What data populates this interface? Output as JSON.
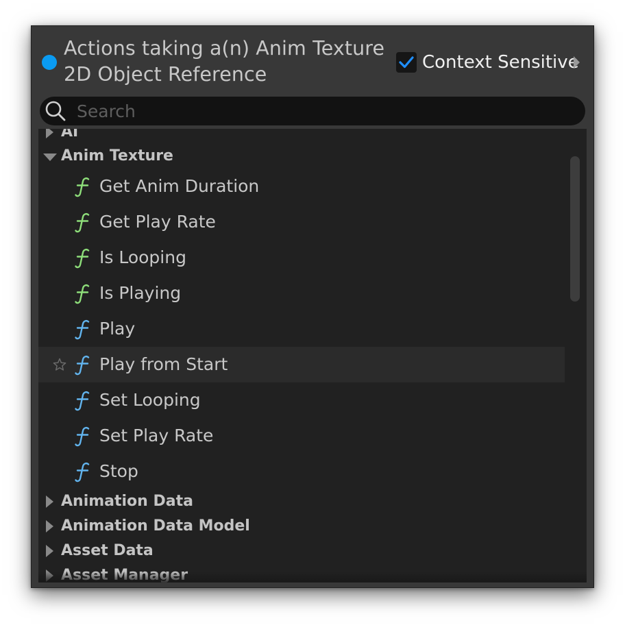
{
  "header": {
    "title": "Actions taking a(n) Anim Texture 2D Object Reference",
    "context_sensitive_label": "Context Sensitive",
    "context_sensitive_checked": true,
    "pin_color": "#0a9bf2"
  },
  "search": {
    "placeholder": "Search",
    "value": ""
  },
  "categories": {
    "ai": "AI",
    "anim_texture": "Anim Texture",
    "animation_data": "Animation Data",
    "animation_data_model": "Animation Data Model",
    "asset_data": "Asset Data",
    "asset_manager": "Asset Manager"
  },
  "anim_texture_items": [
    {
      "label": "Get Anim Duration",
      "icon": "function-pure-icon",
      "icon_color": "#8ede7a"
    },
    {
      "label": "Get Play Rate",
      "icon": "function-pure-icon",
      "icon_color": "#8ede7a"
    },
    {
      "label": "Is Looping",
      "icon": "function-pure-icon",
      "icon_color": "#8ede7a"
    },
    {
      "label": "Is Playing",
      "icon": "function-pure-icon",
      "icon_color": "#8ede7a"
    },
    {
      "label": "Play",
      "icon": "function-icon",
      "icon_color": "#62b4ee"
    },
    {
      "label": "Play from Start",
      "icon": "function-icon",
      "icon_color": "#62b4ee",
      "hovered": true,
      "favorite_star": true
    },
    {
      "label": "Set Looping",
      "icon": "function-icon",
      "icon_color": "#62b4ee"
    },
    {
      "label": "Set Play Rate",
      "icon": "function-icon",
      "icon_color": "#62b4ee"
    },
    {
      "label": "Stop",
      "icon": "function-icon",
      "icon_color": "#62b4ee"
    }
  ],
  "colors": {
    "pure_function": "#8ede7a",
    "impure_function": "#62b4ee",
    "checkmark": "#1f8fff"
  }
}
